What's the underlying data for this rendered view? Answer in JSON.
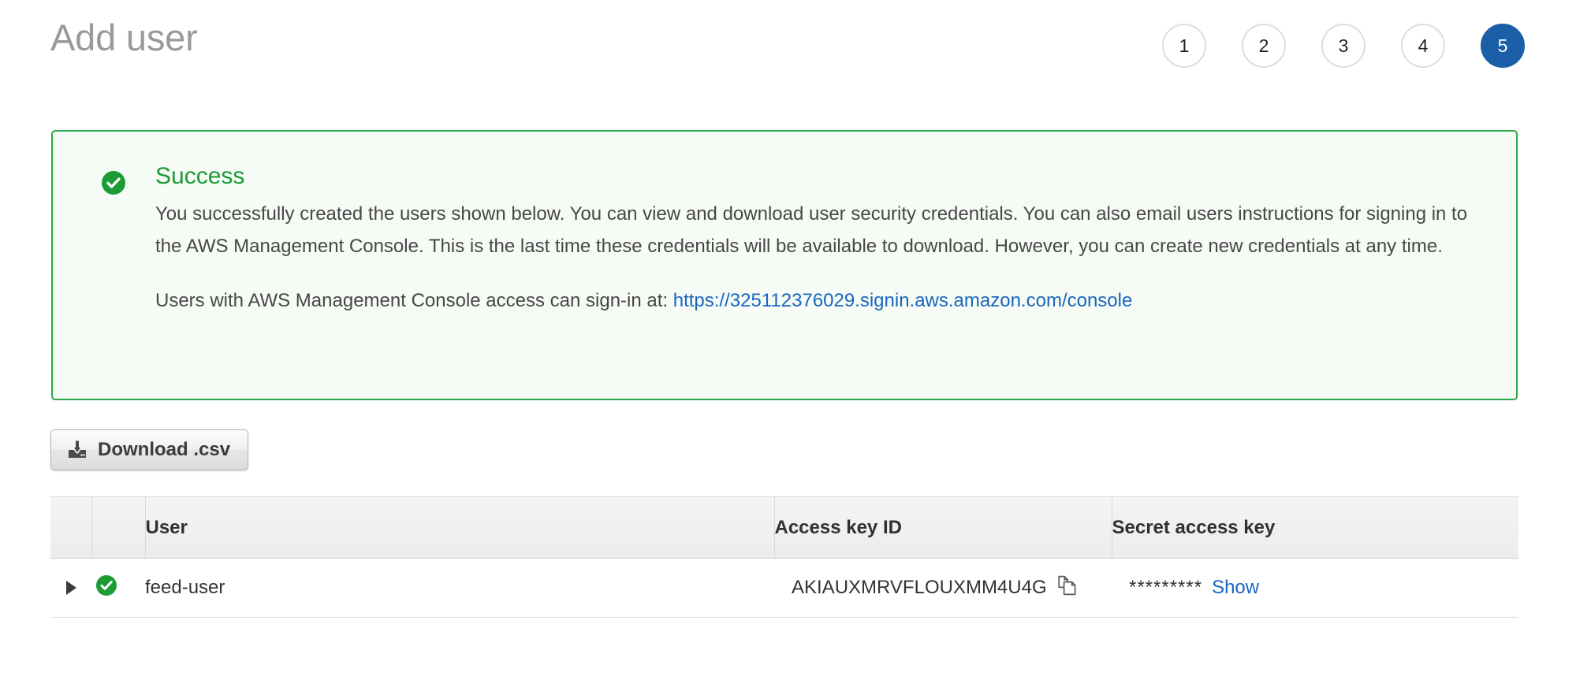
{
  "header": {
    "title": "Add user",
    "steps": [
      {
        "label": "1",
        "active": false
      },
      {
        "label": "2",
        "active": false
      },
      {
        "label": "3",
        "active": false
      },
      {
        "label": "4",
        "active": false
      },
      {
        "label": "5",
        "active": true
      }
    ]
  },
  "alert": {
    "status_icon": "check-circle-icon",
    "heading": "Success",
    "paragraph1": "You successfully created the users shown below. You can view and download user security credentials. You can also email users instructions for signing in to the AWS Management Console. This is the last time these credentials will be available to download. However, you can create new credentials at any time.",
    "paragraph2_prefix": "Users with AWS Management Console access can sign-in at: ",
    "signin_url": "https://325112376029.signin.aws.amazon.com/console",
    "border_color": "#2aa84a",
    "background_color": "#f6fbf5",
    "heading_color": "#1c9c34"
  },
  "toolbar": {
    "download_label": "Download .csv",
    "download_icon": "download-icon"
  },
  "table": {
    "columns": [
      "",
      "",
      "User",
      "Access key ID",
      "Secret access key"
    ],
    "rows": [
      {
        "expand_icon": "triangle-right-icon",
        "status_icon": "check-circle-icon",
        "user": "feed-user",
        "access_key_id": "AKIAUXMRVFLOUXMM4U4G",
        "copy_icon": "copy-icon",
        "secret_mask": "*********",
        "show_label": "Show"
      }
    ]
  },
  "colors": {
    "accent_blue": "#1b5fa8",
    "link_blue": "#1866c0",
    "success_green": "#1c9c34",
    "title_gray": "#9a9a9a"
  }
}
